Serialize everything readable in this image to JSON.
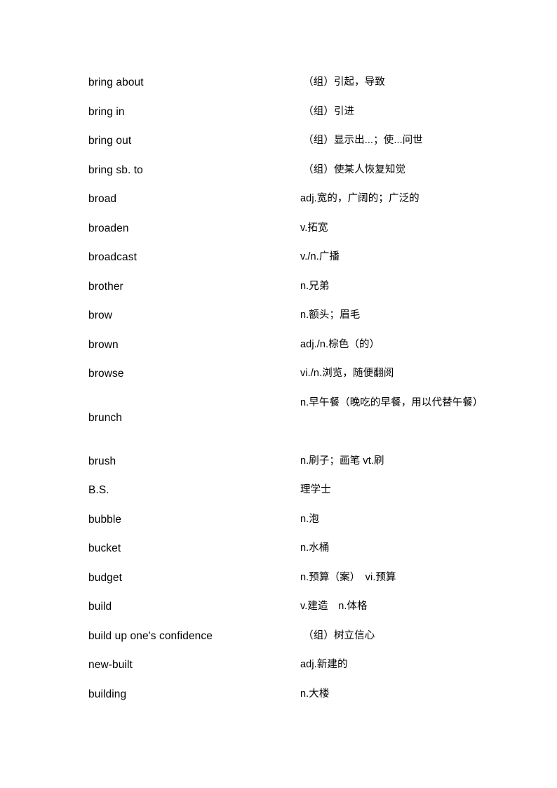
{
  "document": {
    "kind": "vocabulary-glossary-page",
    "language_pair": "English-Chinese",
    "background_color": "#ffffff",
    "text_color": "#000000"
  },
  "glossary": {
    "entries": [
      {
        "term": "bring about",
        "definition": " （组）引起，导致"
      },
      {
        "term": "bring in",
        "definition": " （组）引进"
      },
      {
        "term": "bring out",
        "definition": " （组）显示出...；使...问世"
      },
      {
        "term": "bring sb. to",
        "definition": " （组）使某人恢复知觉"
      },
      {
        "term": "broad",
        "definition": "adj.宽的，广阔的；广泛的"
      },
      {
        "term": "broaden",
        "definition": "v.拓宽"
      },
      {
        "term": "broadcast",
        "definition": "v./n.广播"
      },
      {
        "term": "brother",
        "definition": "n.兄弟"
      },
      {
        "term": "brow",
        "definition": "n.额头；眉毛"
      },
      {
        "term": "brown",
        "definition": "adj./n.棕色（的）"
      },
      {
        "term": "browse",
        "definition": "vi./n.浏览，随便翻阅"
      },
      {
        "term": "brunch",
        "definition": "n.早午餐（晚吃的早餐，用以代替午餐）",
        "wraps": true
      },
      {
        "term": "brush",
        "definition": "n.刷子；画笔 vt.刷"
      },
      {
        "term": "B.S.",
        "definition": "理学士"
      },
      {
        "term": "bubble",
        "definition": "n.泡"
      },
      {
        "term": "bucket",
        "definition": "n.水桶"
      },
      {
        "term": "budget",
        "definition": "n.预算（案）　vi.预算"
      },
      {
        "term": "build",
        "definition": "v.建造　n.体格"
      },
      {
        "term": "build up one's confidence",
        "definition": " （组）树立信心"
      },
      {
        "term": "new-built",
        "definition": "adj.新建的"
      },
      {
        "term": "building",
        "definition": "n.大楼"
      }
    ]
  }
}
